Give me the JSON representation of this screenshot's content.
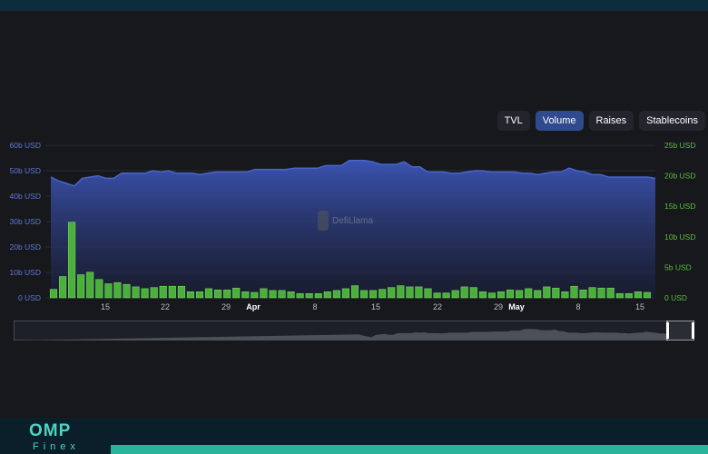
{
  "tabs": [
    {
      "label": "TVL",
      "active": false
    },
    {
      "label": "Volume",
      "active": true
    },
    {
      "label": "Raises",
      "active": false
    },
    {
      "label": "Stablecoins",
      "active": false
    }
  ],
  "watermark": "DefiLlama",
  "brand": {
    "name": "OMP",
    "sub": "Finex"
  },
  "colors": {
    "tvl_line": "#4965c8",
    "bars": "#4caf3c",
    "bar_stroke": "#7be06a",
    "left_axis": "#5e79d6",
    "right_axis": "#5bbf3f",
    "accent": "#29b59c"
  },
  "chart_data": {
    "type": "bar",
    "x_ticks": [
      "15",
      "22",
      "29",
      "Apr",
      "8",
      "15",
      "22",
      "29",
      "May",
      "8",
      "15"
    ],
    "y_left": {
      "ticks": [
        "0 USD",
        "10b USD",
        "20b USD",
        "30b USD",
        "40b USD",
        "50b USD",
        "60b USD"
      ],
      "range": [
        0,
        60
      ],
      "unit": "billion USD"
    },
    "y_right": {
      "ticks": [
        "0 USD",
        "5b USD",
        "10b USD",
        "15b USD",
        "20b USD",
        "25b USD"
      ],
      "range": [
        0,
        25
      ],
      "unit": "billion USD"
    },
    "series": [
      {
        "type": "area",
        "axis": "left",
        "values": [
          47.5,
          46,
          45,
          44,
          47,
          47.5,
          48,
          47,
          47,
          49,
          49,
          49,
          49,
          50,
          49.5,
          50,
          49,
          49,
          49,
          48.5,
          49,
          49.5,
          49.5,
          49.5,
          49.5,
          49.5,
          50.5,
          50.5,
          50.5,
          50.5,
          50.5,
          51,
          51,
          51,
          51,
          52,
          52,
          52,
          54,
          54,
          54,
          53.5,
          52.5,
          52.5,
          52.5,
          53.5,
          51.5,
          51.5,
          49.5,
          49.5,
          49.5,
          49,
          49,
          49.5,
          50,
          50,
          49.5,
          49.5,
          49.5,
          49.5,
          49,
          49,
          48.5,
          49,
          49.5,
          49.5,
          51,
          50,
          49.5,
          48.5,
          48.5,
          47.5,
          47.5,
          47.5,
          47.5,
          47.5,
          47.5,
          47
        ]
      },
      {
        "type": "bar",
        "axis": "right",
        "values": [
          1.4,
          3.5,
          12.4,
          3.8,
          4.2,
          3.0,
          2.3,
          2.5,
          2.2,
          1.8,
          1.5,
          1.7,
          1.9,
          1.9,
          1.9,
          1.0,
          1.0,
          1.5,
          1.3,
          1.3,
          1.6,
          1.0,
          0.9,
          1.5,
          1.2,
          1.2,
          1.0,
          0.7,
          0.7,
          0.7,
          1.0,
          1.2,
          1.5,
          2.0,
          1.2,
          1.2,
          1.4,
          1.7,
          2.0,
          1.8,
          1.8,
          1.5,
          0.8,
          0.8,
          1.2,
          1.8,
          1.7,
          1.0,
          0.8,
          1.0,
          1.3,
          1.2,
          1.5,
          1.2,
          1.8,
          1.6,
          1.0,
          1.9,
          1.3,
          1.7,
          1.6,
          1.6,
          0.7,
          0.7,
          1.0,
          0.9
        ]
      }
    ]
  }
}
